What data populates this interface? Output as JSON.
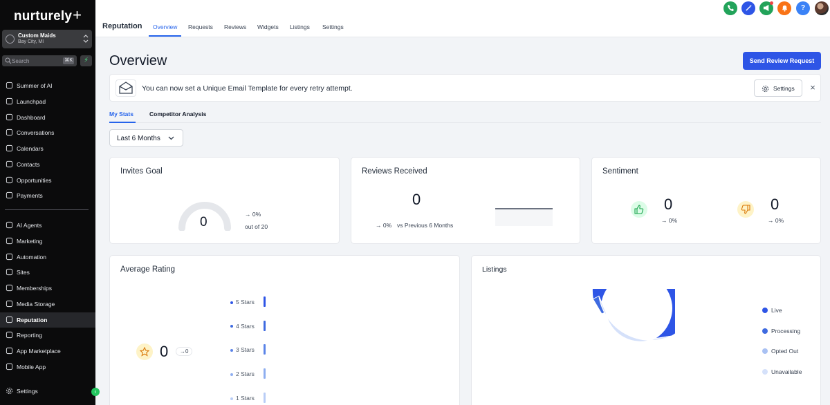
{
  "sidebar": {
    "logo": "nurturely",
    "logo_plus": "+",
    "account": {
      "name": "Custom Maids",
      "location": "Bay City, MI"
    },
    "search": {
      "placeholder": "Search",
      "shortcut": "⌘K"
    },
    "items_top": [
      {
        "label": "Summer of AI",
        "icon": "sparkle-icon"
      },
      {
        "label": "Launchpad",
        "icon": "rocket-icon"
      },
      {
        "label": "Dashboard",
        "icon": "dashboard-icon"
      },
      {
        "label": "Conversations",
        "icon": "chat-icon"
      },
      {
        "label": "Calendars",
        "icon": "calendar-icon"
      },
      {
        "label": "Contacts",
        "icon": "contacts-icon"
      },
      {
        "label": "Opportunities",
        "icon": "opportunities-icon"
      },
      {
        "label": "Payments",
        "icon": "payments-icon"
      }
    ],
    "items_bottom": [
      {
        "label": "AI Agents",
        "icon": "sparkle-icon"
      },
      {
        "label": "Marketing",
        "icon": "send-icon"
      },
      {
        "label": "Automation",
        "icon": "automation-icon"
      },
      {
        "label": "Sites",
        "icon": "sites-icon"
      },
      {
        "label": "Memberships",
        "icon": "memberships-icon"
      },
      {
        "label": "Media Storage",
        "icon": "image-icon"
      },
      {
        "label": "Reputation",
        "icon": "star-icon",
        "active": true
      },
      {
        "label": "Reporting",
        "icon": "trend-icon"
      },
      {
        "label": "App Marketplace",
        "icon": "apps-icon"
      },
      {
        "label": "Mobile App",
        "icon": "mobile-icon"
      }
    ],
    "settings_label": "Settings"
  },
  "header": {
    "title": "Reputation",
    "tabs": [
      "Overview",
      "Requests",
      "Reviews",
      "Widgets",
      "Listings",
      "Settings"
    ],
    "active_tab": "Overview"
  },
  "main": {
    "title": "Overview",
    "primary_button": "Send Review Request",
    "banner": {
      "message": "You can now set a Unique Email Template for every retry attempt.",
      "settings_label": "Settings"
    },
    "subtabs": [
      "My Stats",
      "Competitor Analysis"
    ],
    "period": "Last 6 Months"
  },
  "cards": {
    "invites": {
      "title": "Invites Goal",
      "value": "0",
      "change": "0%",
      "goal_text": "out of 20"
    },
    "reviews": {
      "title": "Reviews Received",
      "value": "0",
      "change": "0%",
      "compare": "vs Previous 6 Months"
    },
    "sentiment": {
      "title": "Sentiment",
      "positive": "0",
      "positive_change": "0%",
      "negative": "0",
      "negative_change": "0%"
    },
    "rating": {
      "title": "Average Rating",
      "value": "0",
      "change": "0",
      "rows": [
        {
          "label": "5 Stars",
          "color": "#2e55e6"
        },
        {
          "label": "4 Stars",
          "color": "#3e6ae0"
        },
        {
          "label": "3 Stars",
          "color": "#5b84e8"
        },
        {
          "label": "2 Stars",
          "color": "#8eaef0"
        },
        {
          "label": "1 Stars",
          "color": "#b9cdf6"
        }
      ]
    },
    "listings": {
      "title": "Listings",
      "legend": [
        {
          "label": "Live",
          "color": "#2e55e6"
        },
        {
          "label": "Processing",
          "color": "#3e6ae0"
        },
        {
          "label": "Opted Out",
          "color": "#a9c1f3"
        },
        {
          "label": "Unavailable",
          "color": "#d5e1fa"
        }
      ]
    }
  },
  "chart_data": {
    "type": "pie",
    "categories": [
      "Live",
      "Processing",
      "Opted Out",
      "Unavailable"
    ],
    "values": [
      69,
      2,
      0,
      29
    ]
  }
}
